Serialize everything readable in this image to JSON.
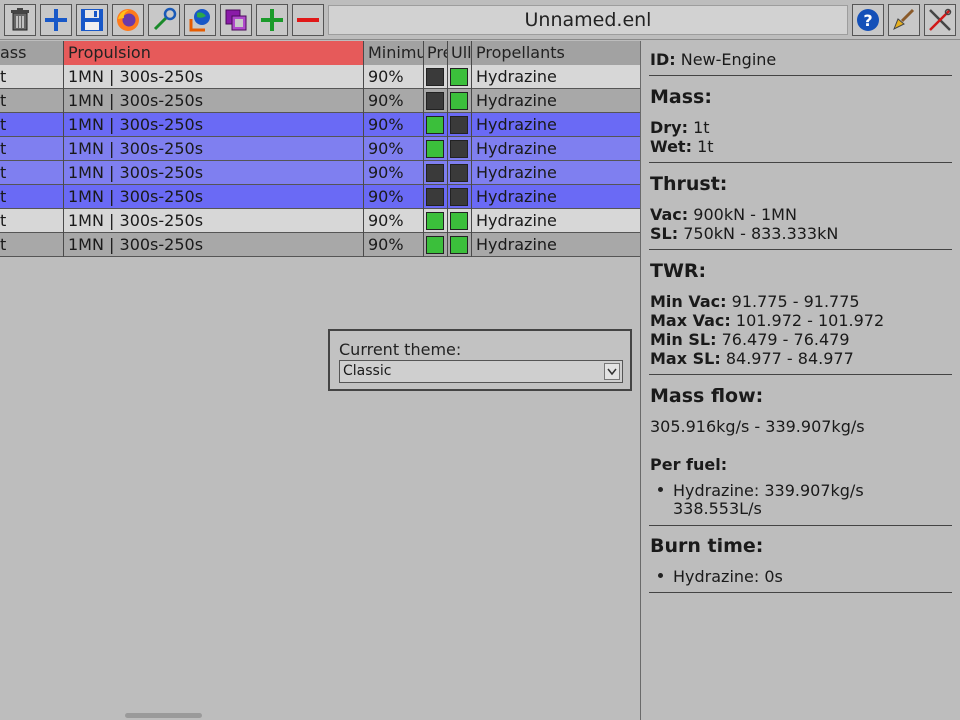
{
  "toolbar": {
    "title": "Unnamed.enl",
    "buttons": [
      "trash-icon",
      "new-icon",
      "save-icon",
      "firefox-icon",
      "validate-icon",
      "export-icon",
      "duplicate-icon",
      "add-icon",
      "remove-icon"
    ],
    "right_buttons": [
      "help-icon",
      "theme-brush-icon",
      "settings-tools-icon"
    ]
  },
  "table": {
    "headers": {
      "class": "ass",
      "propulsion": "Propulsion",
      "minimum": "Minimu",
      "pressure": "Pre",
      "ullage": "Ull",
      "propellants": "Propellants"
    },
    "rows": [
      {
        "class": "t",
        "propulsion": "1MN | 300s-250s",
        "minimum": "90%",
        "pressure": "dark",
        "ullage": "green",
        "propellants": "Hydrazine",
        "bg": "light"
      },
      {
        "class": "t",
        "propulsion": "1MN | 300s-250s",
        "minimum": "90%",
        "pressure": "dark",
        "ullage": "green",
        "propellants": "Hydrazine",
        "bg": "dark"
      },
      {
        "class": "t",
        "propulsion": "1MN | 300s-250s",
        "minimum": "90%",
        "pressure": "green",
        "ullage": "dark",
        "propellants": "Hydrazine",
        "bg": "selb"
      },
      {
        "class": "t",
        "propulsion": "1MN | 300s-250s",
        "minimum": "90%",
        "pressure": "green",
        "ullage": "dark",
        "propellants": "Hydrazine",
        "bg": "sel"
      },
      {
        "class": "t",
        "propulsion": "1MN | 300s-250s",
        "minimum": "90%",
        "pressure": "dark",
        "ullage": "dark",
        "propellants": "Hydrazine",
        "bg": "sel"
      },
      {
        "class": "t",
        "propulsion": "1MN | 300s-250s",
        "minimum": "90%",
        "pressure": "dark",
        "ullage": "dark",
        "propellants": "Hydrazine",
        "bg": "selb"
      },
      {
        "class": "t",
        "propulsion": "1MN | 300s-250s",
        "minimum": "90%",
        "pressure": "green",
        "ullage": "green",
        "propellants": "Hydrazine",
        "bg": "light"
      },
      {
        "class": "t",
        "propulsion": "1MN | 300s-250s",
        "minimum": "90%",
        "pressure": "green",
        "ullage": "green",
        "propellants": "Hydrazine",
        "bg": "dark"
      }
    ]
  },
  "theme": {
    "label": "Current theme:",
    "value": "Classic"
  },
  "panel": {
    "id_label": "ID:",
    "id_value": "New-Engine",
    "mass": {
      "heading": "Mass:",
      "dry_label": "Dry:",
      "dry_value": "1t",
      "wet_label": "Wet:",
      "wet_value": "1t"
    },
    "thrust": {
      "heading": "Thrust:",
      "vac_label": "Vac:",
      "vac_value": "900kN - 1MN",
      "sl_label": "SL:",
      "sl_value": "750kN - 833.333kN"
    },
    "twr": {
      "heading": "TWR:",
      "min_vac_label": "Min Vac:",
      "min_vac_value": "91.775 - 91.775",
      "max_vac_label": "Max Vac:",
      "max_vac_value": "101.972 - 101.972",
      "min_sl_label": "Min SL:",
      "min_sl_value": "76.479 - 76.479",
      "max_sl_label": "Max SL:",
      "max_sl_value": "84.977 - 84.977"
    },
    "mass_flow": {
      "heading": "Mass flow:",
      "value": "305.916kg/s - 339.907kg/s",
      "per_fuel_label": "Per fuel:",
      "fuel_line1": "Hydrazine: 339.907kg/s",
      "fuel_line2": "338.553L/s"
    },
    "burn_time": {
      "heading": "Burn time:",
      "item": "Hydrazine: 0s"
    }
  },
  "colors": {
    "sorted_header": "#e65a5a",
    "selected_row": "#7f7ff0",
    "selected_row_strong": "#6a6af5",
    "status_green": "#3bbf3b",
    "status_dark": "#3a3a3a"
  }
}
